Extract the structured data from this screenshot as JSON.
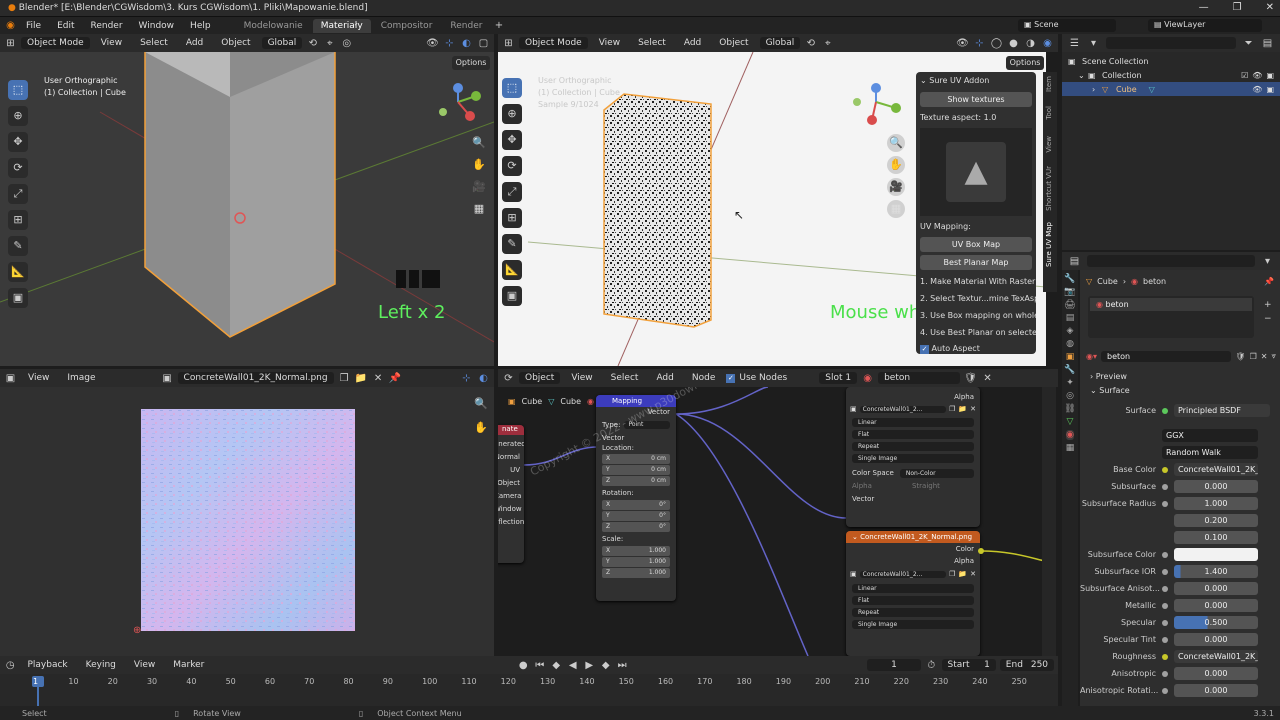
{
  "window": {
    "title": "Blender* [E:\\Blender\\CGWisdom\\3. Kurs CGWisdom\\1. Pliki\\Mapowanie.blend]",
    "controls": [
      "—",
      "❐",
      "✕"
    ]
  },
  "menu": [
    "File",
    "Edit",
    "Render",
    "Window",
    "Help"
  ],
  "workspaces": [
    "Modelowanie",
    "Materiały",
    "Compositor",
    "Render"
  ],
  "scene": "Scene",
  "view_layer": "ViewLayer",
  "vp1": {
    "mode": "Object Mode",
    "menus": [
      "View",
      "Select",
      "Add",
      "Object"
    ],
    "orientation": "Global",
    "options": "Options",
    "view_name": "User Orthographic",
    "collection": "(1) Collection | Cube",
    "overlay_text": "Left x 2"
  },
  "vp2": {
    "mode": "Object Mode",
    "menus": [
      "View",
      "Select",
      "Add",
      "Object"
    ],
    "orientation": "Global",
    "options": "Options",
    "view_name": "User Orthographic",
    "collection": "(1) Collection | Cube",
    "samples": "Sample 9/1024",
    "overlay_text": "Mouse wh",
    "panel": {
      "title": "Sure UV Addon",
      "show_textures": "Show textures",
      "texture_aspect": "Texture aspect: 1.0",
      "uv_mapping": "UV Mapping:",
      "uv_box_map": "UV Box Map",
      "best_planar_map": "Best Planar Map",
      "steps": [
        "1. Make Material With Raster Te...",
        "2. Select Textur...mine TexAspect",
        "3. Use Box mapping on whole o...",
        "4. Use Best Planar on selected f..."
      ],
      "auto_aspect": "Auto Aspect"
    },
    "side_tabs": [
      "Item",
      "Tool",
      "View",
      "Shortcut VUr",
      "Sure UV Map"
    ]
  },
  "outliner": {
    "scene_collection": "Scene Collection",
    "collection": "Collection",
    "cube": "Cube"
  },
  "image_editor": {
    "menus": [
      "View",
      "Image"
    ],
    "image_name": "ConcreteWall01_2K_Normal.png"
  },
  "node_editor": {
    "object_label": "Object",
    "menus": [
      "View",
      "Select",
      "Add",
      "Node"
    ],
    "use_nodes": "Use Nodes",
    "slot": "Slot 1",
    "material": "beton",
    "breadcrumb": [
      "Cube",
      "Cube",
      "beton"
    ],
    "texcoord": {
      "title": "nate",
      "outputs": [
        "enerated",
        "Normal",
        "UV",
        "Object",
        "Camera",
        "Window",
        "eflection"
      ]
    },
    "mapping": {
      "title": "Mapping",
      "out": "Vector",
      "type_label": "Type:",
      "type_value": "Point",
      "in_vector": "Vector",
      "location": "Location:",
      "loc": [
        [
          "X",
          "0 cm"
        ],
        [
          "Y",
          "0 cm"
        ],
        [
          "Z",
          "0 cm"
        ]
      ],
      "rotation": "Rotation:",
      "rot": [
        [
          "X",
          "0°"
        ],
        [
          "Y",
          "0°"
        ],
        [
          "Z",
          "0°"
        ]
      ],
      "scale": "Scale:",
      "scl": [
        [
          "X",
          "1.000"
        ],
        [
          "Y",
          "1.000"
        ],
        [
          "Z",
          "1.000"
        ]
      ]
    },
    "tex1": {
      "name": "ConcreteWall01_2...",
      "alpha": "Alpha",
      "interp": "Linear",
      "proj": "Flat",
      "ext": "Repeat",
      "src": "Single Image",
      "cs_label": "Color Space",
      "cs_value": "Non-Color",
      "alpha_label": "Alpha",
      "alpha_value": "Straight",
      "vector": "Vector"
    },
    "tex2": {
      "title": "ConcreteWall01_2K_Normal.png",
      "color": "Color",
      "alpha": "Alpha",
      "name": "ConcreteWall01_2...",
      "interp": "Linear",
      "proj": "Flat",
      "ext": "Repeat",
      "src": "Single Image"
    },
    "watermark": "Copyright © 2022 - www.p30download.com"
  },
  "properties": {
    "breadcrumb": [
      "Cube",
      "beton"
    ],
    "slot_name": "beton",
    "material": "beton",
    "preview": "Preview",
    "surface_section": "Surface",
    "surface_label": "Surface",
    "surface_value": "Principled BSDF",
    "distribution": "GGX",
    "sss_method": "Random Walk",
    "rows": [
      {
        "label": "Base Color",
        "value": "ConcreteWall01_2K_Ba...",
        "kind": "link"
      },
      {
        "label": "Subsurface",
        "value": "0.000",
        "kind": "num"
      },
      {
        "label": "Subsurface Radius",
        "value": "1.000",
        "kind": "num"
      },
      {
        "label": "",
        "value": "0.200",
        "kind": "num"
      },
      {
        "label": "",
        "value": "0.100",
        "kind": "num"
      },
      {
        "label": "Subsurface Color",
        "value": "",
        "kind": "color"
      },
      {
        "label": "Subsurface IOR",
        "value": "1.400",
        "kind": "bar"
      },
      {
        "label": "Subsurface Anisot...",
        "value": "0.000",
        "kind": "num"
      },
      {
        "label": "Metallic",
        "value": "0.000",
        "kind": "num"
      },
      {
        "label": "Specular",
        "value": "0.500",
        "kind": "bar"
      },
      {
        "label": "Specular Tint",
        "value": "0.000",
        "kind": "num"
      },
      {
        "label": "Roughness",
        "value": "ConcreteWall01_2K_Ro...",
        "kind": "link"
      },
      {
        "label": "Anisotropic",
        "value": "0.000",
        "kind": "num"
      },
      {
        "label": "Anisotropic Rotati...",
        "value": "0.000",
        "kind": "num"
      }
    ]
  },
  "timeline": {
    "menus": [
      "Playback",
      "Keying",
      "View",
      "Marker"
    ],
    "current_frame": "1",
    "start_label": "Start",
    "start": "1",
    "end_label": "End",
    "end": "250",
    "ticks": [
      "1",
      "10",
      "20",
      "30",
      "40",
      "50",
      "60",
      "70",
      "80",
      "90",
      "100",
      "110",
      "120",
      "130",
      "140",
      "150",
      "160",
      "170",
      "180",
      "190",
      "200",
      "210",
      "220",
      "230",
      "240",
      "250"
    ]
  },
  "status": {
    "select": "Select",
    "rotate": "Rotate View",
    "context": "Object Context Menu",
    "version": "3.3.1"
  }
}
